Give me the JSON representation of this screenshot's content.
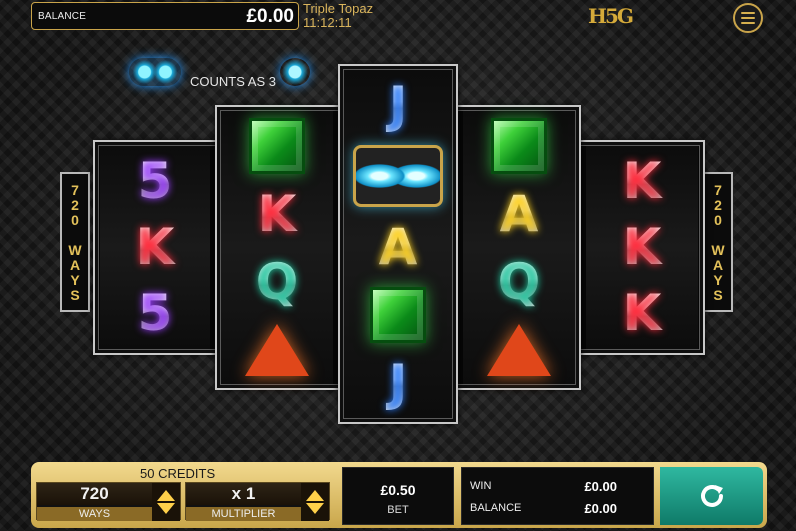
{
  "top_bar": {
    "balance_label": "BALANCE",
    "balance_value": "£0.00",
    "game_title": "Triple Topaz",
    "clock": "11:12:11",
    "logo_text": "H5G"
  },
  "counts_as": {
    "text": "COUNTS AS 3"
  },
  "ways": {
    "left": "720 WAYS",
    "right": "720 WAYS"
  },
  "reels": {
    "r1": [
      "5",
      "K",
      "5"
    ],
    "r2": [
      "emerald",
      "K",
      "Q",
      "ruby"
    ],
    "r3": [
      "J",
      "topaz",
      "A",
      "emerald",
      "J"
    ],
    "r4": [
      "emerald",
      "A",
      "Q",
      "ruby"
    ],
    "r5": [
      "K",
      "K",
      "K"
    ]
  },
  "controls": {
    "credits_label": "50 CREDITS",
    "ways_value": "720",
    "ways_caption": "WAYS",
    "multiplier_value": "x 1",
    "multiplier_caption": "MULTIPLIER",
    "bet_value": "£0.50",
    "bet_caption": "BET",
    "win_label": "WIN",
    "win_value": "£0.00",
    "balance_label": "BALANCE",
    "balance_value": "£0.00"
  },
  "icons": {
    "menu": "hamburger-menu-icon",
    "spin": "spin-refresh-icon",
    "up": "arrow-up-icon",
    "down": "arrow-down-icon"
  },
  "colors": {
    "gold": "#c9a44a",
    "panel": "#e6c979",
    "spin": "#1f9a84"
  }
}
